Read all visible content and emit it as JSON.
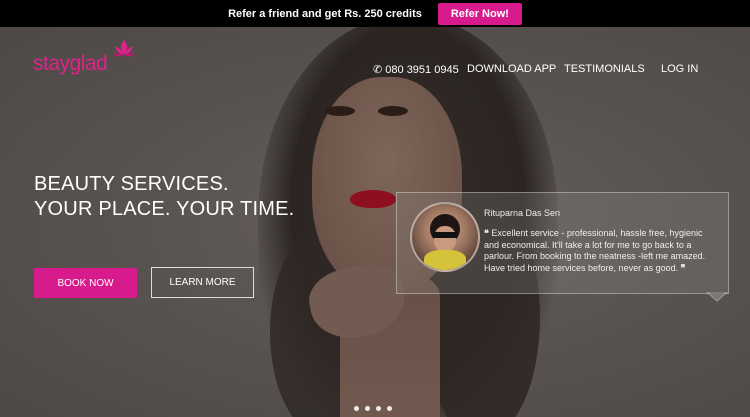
{
  "promo": {
    "text": "Refer a friend and get Rs. 250 credits",
    "cta_label": "Refer Now!"
  },
  "brand": {
    "logo_text": "stayglad",
    "accent_color": "#d81b8c"
  },
  "nav": {
    "phone": "080 3951 0945",
    "items": [
      "DOWNLOAD APP",
      "TESTIMONIALS",
      "LOG IN"
    ]
  },
  "hero": {
    "headline_line1": "BEAUTY SERVICES.",
    "headline_line2": "YOUR PLACE. YOUR TIME.",
    "book_label": "BOOK NOW",
    "learn_label": "LEARN MORE"
  },
  "testimonial": {
    "name": "Rituparna Das Sen",
    "open_quote": "❝",
    "text": "Excellent service - professional, hassle free, hygienic and economical. It'll take a lot for me to go back to a parlour. From booking to the neatness -left me amazed. Have tried home services before, never as good.",
    "close_quote": "❞"
  },
  "carousel": {
    "count": 4,
    "active": 1
  }
}
